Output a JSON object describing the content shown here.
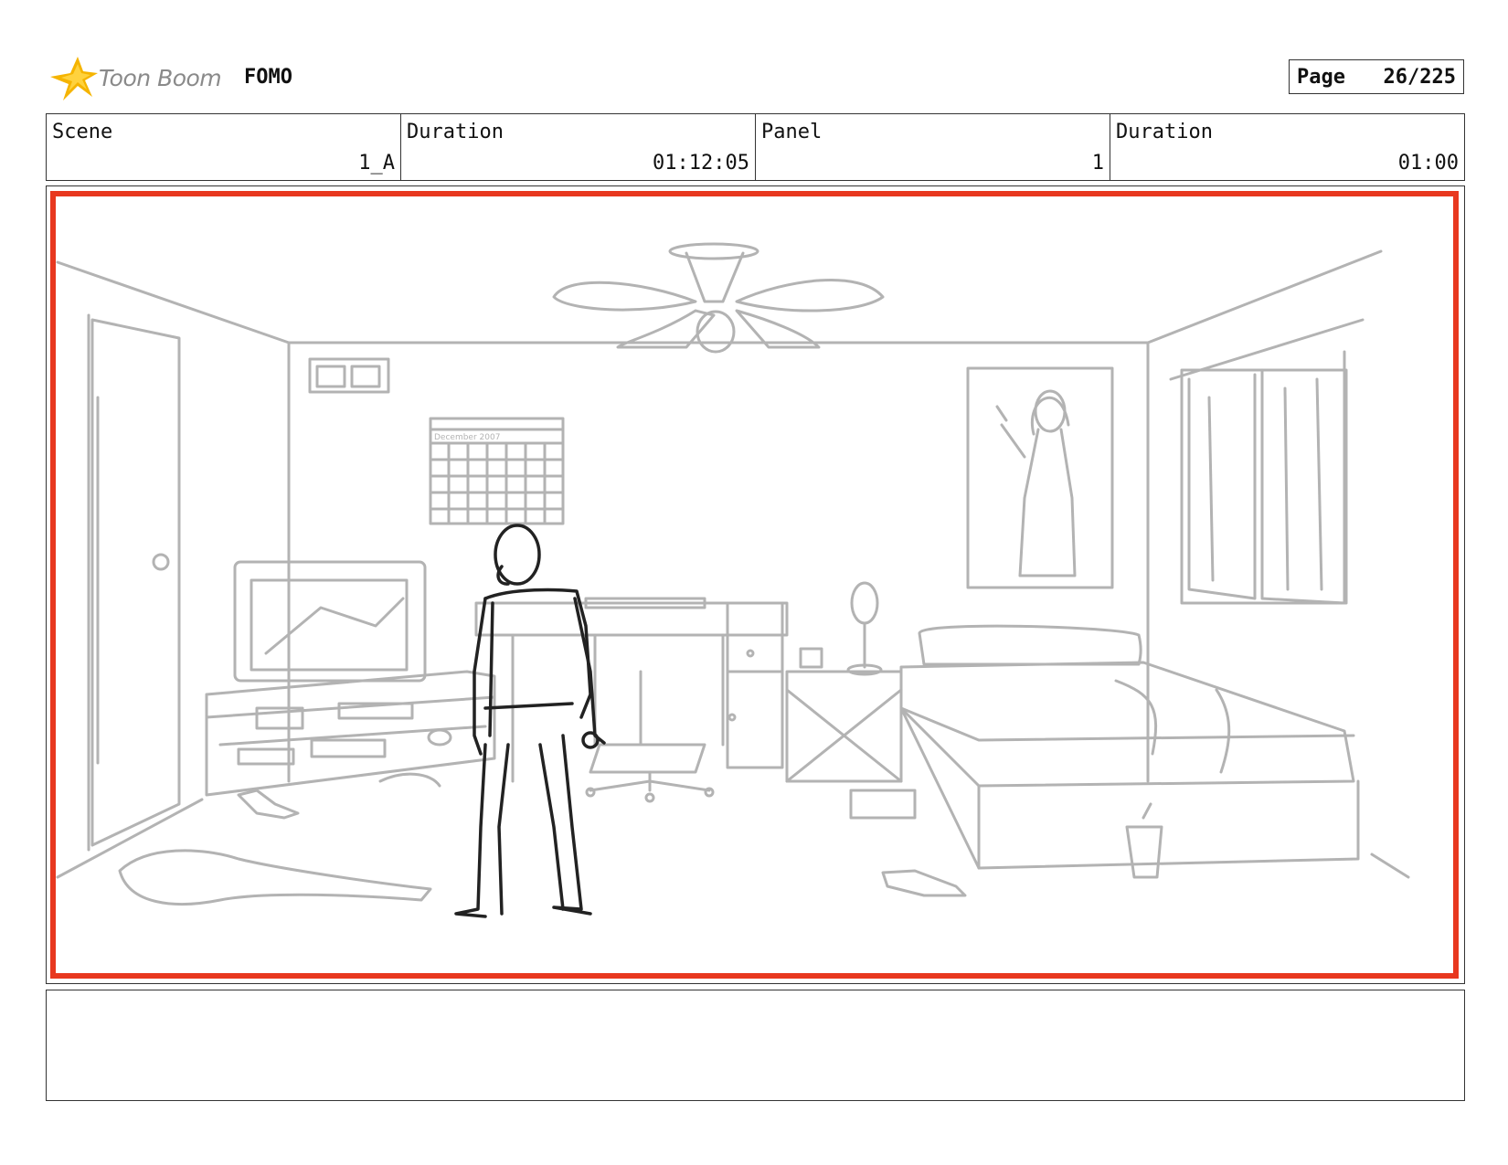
{
  "header": {
    "logo_text": "Toon Boom",
    "project_title": "FOMO",
    "page_label": "Page",
    "page_value": "26/225"
  },
  "info": [
    {
      "label": "Scene",
      "value": "1_A"
    },
    {
      "label": "Duration",
      "value": "01:12:05"
    },
    {
      "label": "Panel",
      "value": "1"
    },
    {
      "label": "Duration",
      "value": "01:00"
    }
  ],
  "panel": {
    "frame_color": "#e8381f",
    "calendar_text": "December 2007"
  },
  "notes": {
    "text": ""
  },
  "colors": {
    "logo_star": "#f5b400",
    "sketch_gray": "#b3b3b3",
    "character_ink": "#222222"
  }
}
